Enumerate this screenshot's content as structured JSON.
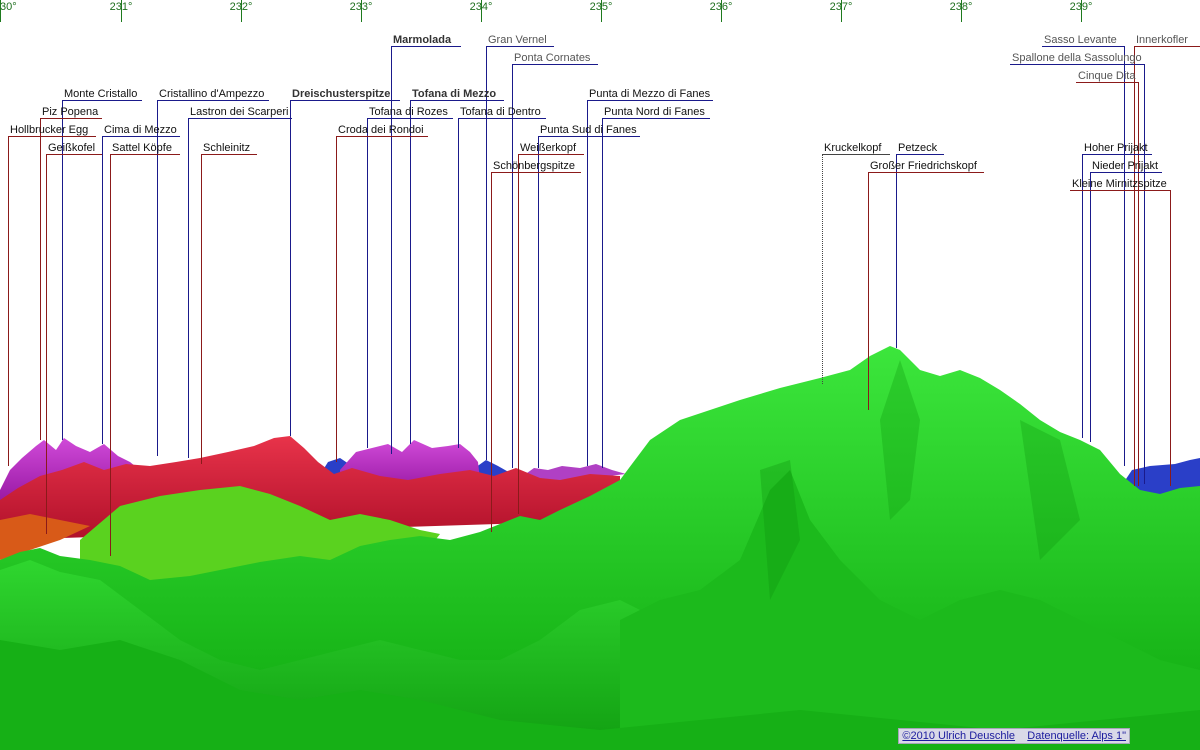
{
  "axis": {
    "ticks": [
      "30°",
      "231°",
      "232°",
      "233°",
      "234°",
      "235°",
      "236°",
      "237°",
      "238°",
      "239°"
    ]
  },
  "peaks": [
    {
      "name": "Marmolada",
      "style": "bold"
    },
    {
      "name": "Gran Vernel",
      "style": "grey"
    },
    {
      "name": "Ponta Cornates",
      "style": "grey"
    },
    {
      "name": "Monte Cristallo",
      "style": "normal"
    },
    {
      "name": "Cristallino d'Ampezzo",
      "style": "normal"
    },
    {
      "name": "Dreischusterspitze",
      "style": "bold"
    },
    {
      "name": "Tofana di Mezzo",
      "style": "bold"
    },
    {
      "name": "Punta di Mezzo di Fanes",
      "style": "normal"
    },
    {
      "name": "Piz Popena",
      "style": "normal"
    },
    {
      "name": "Lastron dei Scarperi",
      "style": "normal"
    },
    {
      "name": "Tofana di Rozes",
      "style": "normal"
    },
    {
      "name": "Tofana di Dentro",
      "style": "normal"
    },
    {
      "name": "Punta Nord di Fanes",
      "style": "normal"
    },
    {
      "name": "Hollbrucker Egg",
      "style": "normal"
    },
    {
      "name": "Cima di Mezzo",
      "style": "normal"
    },
    {
      "name": "Croda dei Rondoi",
      "style": "normal"
    },
    {
      "name": "Punta Sud di Fanes",
      "style": "normal"
    },
    {
      "name": "Geißkofel",
      "style": "normal"
    },
    {
      "name": "Sattel Köpfe",
      "style": "normal"
    },
    {
      "name": "Schleinitz",
      "style": "normal"
    },
    {
      "name": "Weißerkopf",
      "style": "normal"
    },
    {
      "name": "Schönbergspitze",
      "style": "normal"
    },
    {
      "name": "Kruckelkopf",
      "style": "normal"
    },
    {
      "name": "Petzeck",
      "style": "normal"
    },
    {
      "name": "Großer Friedrichskopf",
      "style": "normal"
    },
    {
      "name": "Sasso Levante",
      "style": "grey"
    },
    {
      "name": "Innerkofler",
      "style": "grey"
    },
    {
      "name": "Spallone della Sassolungo",
      "style": "grey"
    },
    {
      "name": "Cinque Dita",
      "style": "grey"
    },
    {
      "name": "Hoher Prijakt",
      "style": "normal"
    },
    {
      "name": "Nieder Prijakt",
      "style": "normal"
    },
    {
      "name": "Kleine Mirnitzspitze",
      "style": "normal"
    }
  ],
  "credits": {
    "copyright": "©2010 Ulrich Deuschle",
    "source": "Datenquelle: Alps 1\""
  },
  "colors": {
    "near_terrain": "#22dd22",
    "mid_terrain": "#d6203a",
    "far_terrain": "#b82ac0",
    "farthest_terrain": "#2a3fc8",
    "leader_near": "#8b1a1a",
    "leader_far": "#1a1a8b"
  }
}
